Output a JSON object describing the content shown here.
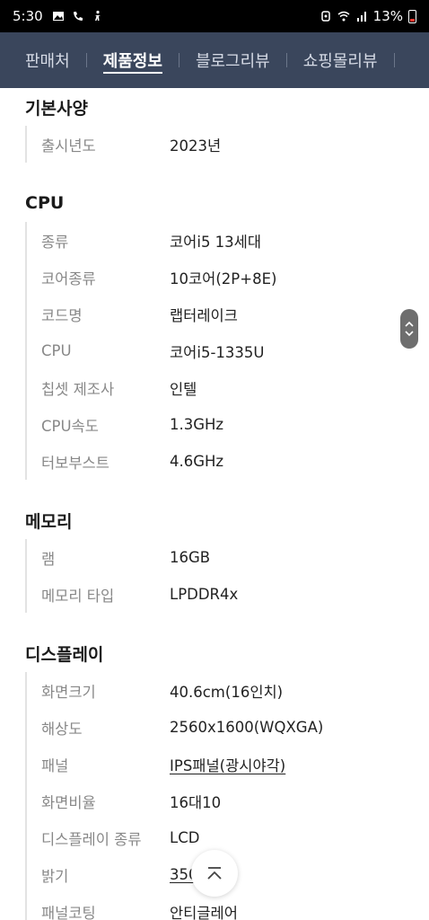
{
  "status_bar": {
    "time": "5:30",
    "battery": "13%",
    "left_icons": [
      "image-icon",
      "call-icon",
      "accessibility-icon"
    ],
    "right_icons": [
      "alarm-icon",
      "wifi-icon",
      "signal-icon",
      "battery-icon"
    ]
  },
  "tabs": [
    {
      "label": "판매처",
      "active": false
    },
    {
      "label": "제품정보",
      "active": true
    },
    {
      "label": "블로그리뷰",
      "active": false
    },
    {
      "label": "쇼핑몰리뷰",
      "active": false
    }
  ],
  "sections": {
    "basic": {
      "title": "기본사양",
      "rows": [
        {
          "label": "출시년도",
          "value": "2023년"
        }
      ]
    },
    "cpu": {
      "title": "CPU",
      "rows": [
        {
          "label": "종류",
          "value": "코어i5 13세대"
        },
        {
          "label": "코어종류",
          "value": "10코어(2P+8E)"
        },
        {
          "label": "코드명",
          "value": "랩터레이크"
        },
        {
          "label": "CPU",
          "value": "코어i5-1335U"
        },
        {
          "label": "칩셋 제조사",
          "value": "인텔"
        },
        {
          "label": "CPU속도",
          "value": "1.3GHz"
        },
        {
          "label": "터보부스트",
          "value": "4.6GHz"
        }
      ]
    },
    "memory": {
      "title": "메모리",
      "rows": [
        {
          "label": "램",
          "value": "16GB"
        },
        {
          "label": "메모리 타입",
          "value": "LPDDR4x"
        }
      ]
    },
    "display": {
      "title": "디스플레이",
      "rows": [
        {
          "label": "화면크기",
          "value": "40.6cm(16인치)"
        },
        {
          "label": "해상도",
          "value": "2560x1600(WQXGA)"
        },
        {
          "label": "패널",
          "value": "IPS패널(광시야각)"
        },
        {
          "label": "화면비율",
          "value": "16대10"
        },
        {
          "label": "디스플레이 종류",
          "value": "LCD"
        },
        {
          "label": "밝기",
          "value": "350"
        },
        {
          "label": "패널코팅",
          "value": "안티글레어"
        }
      ]
    }
  }
}
